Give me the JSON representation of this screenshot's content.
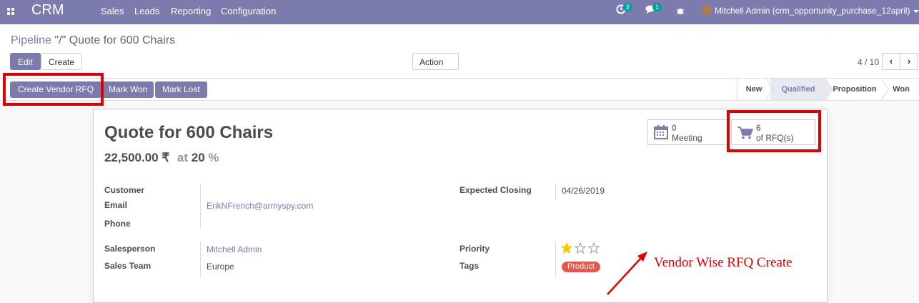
{
  "navbar": {
    "brand": "CRM",
    "menu": [
      "Sales",
      "Leads",
      "Reporting",
      "Configuration"
    ],
    "activity_count": "2",
    "message_count": "1",
    "user": "Mitchell Admin (crm_opportunity_purchase_12april)",
    "icons": [
      "apps-icon",
      "activity-icon",
      "chat-icon",
      "bug-icon",
      "avatar"
    ],
    "accent": "#7c7bad"
  },
  "breadcrumb": {
    "parent": "Pipeline",
    "separator": "\"/\"",
    "current": "Quote for 600 Chairs"
  },
  "toolbar": {
    "edit": "Edit",
    "create": "Create",
    "action": "Action"
  },
  "pager": {
    "value": "4 / 10",
    "prev": "‹",
    "next": "›"
  },
  "header_buttons": {
    "create_vendor_rfq": "Create Vendor RFQ",
    "mark_won": "Mark Won",
    "mark_lost": "Mark Lost"
  },
  "stages": [
    {
      "label": "New",
      "active": false
    },
    {
      "label": "Qualified",
      "active": true
    },
    {
      "label": "Proposition",
      "active": false
    },
    {
      "label": "Won",
      "active": false
    }
  ],
  "smart_buttons": {
    "meeting": {
      "count": "0",
      "label": "Meeting"
    },
    "rfq": {
      "count": "6",
      "label": "of RFQ(s)"
    }
  },
  "record": {
    "title": "Quote for 600 Chairs",
    "revenue": "22,500.00 ₹",
    "at": "at",
    "probability": "20",
    "percent": "%"
  },
  "fields": {
    "customer_label": "Customer",
    "email_label": "Email",
    "email_value": "ErikNFrench@armyspy.com",
    "phone_label": "Phone",
    "expected_closing_label": "Expected Closing",
    "expected_closing_value": "04/26/2019",
    "salesperson_label": "Salesperson",
    "salesperson_value": "Mitchell Admin",
    "sales_team_label": "Sales Team",
    "sales_team_value": "Europe",
    "priority_label": "Priority",
    "priority_stars": 1,
    "priority_max": 3,
    "tags_label": "Tags",
    "tag_value": "Product"
  },
  "annotation": {
    "text": "Vendor Wise RFQ Create",
    "color": "#e00000"
  }
}
